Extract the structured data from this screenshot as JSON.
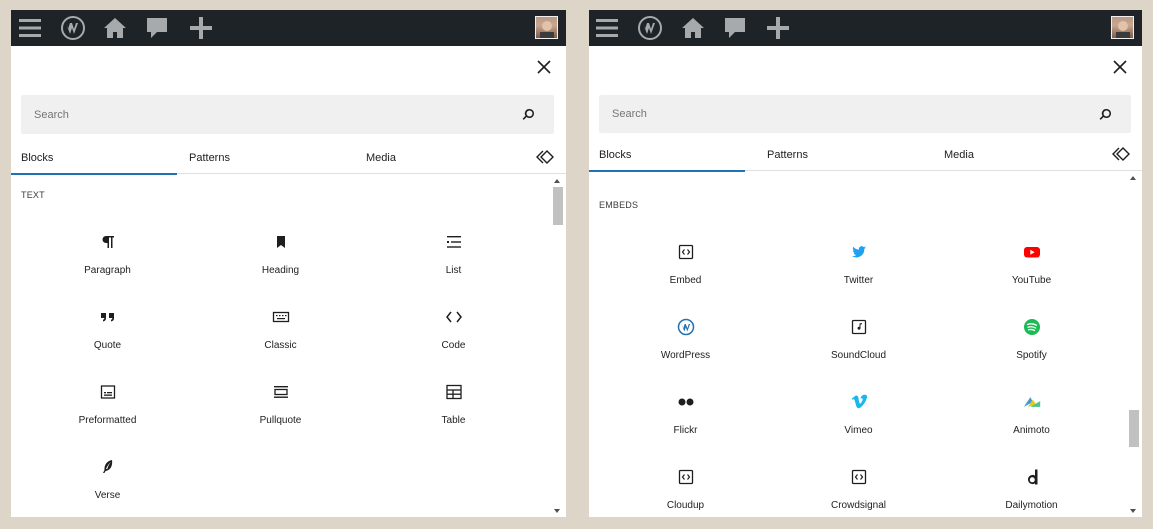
{
  "left_panel": {
    "search": {
      "placeholder": "Search"
    },
    "tabs": [
      {
        "label": "Blocks"
      },
      {
        "label": "Patterns"
      },
      {
        "label": "Media"
      }
    ],
    "category": "TEXT",
    "blocks": [
      {
        "label": "Paragraph",
        "icon": "paragraph-icon"
      },
      {
        "label": "Heading",
        "icon": "heading-icon"
      },
      {
        "label": "List",
        "icon": "list-icon"
      },
      {
        "label": "Quote",
        "icon": "quote-icon"
      },
      {
        "label": "Classic",
        "icon": "classic-icon"
      },
      {
        "label": "Code",
        "icon": "code-icon"
      },
      {
        "label": "Preformatted",
        "icon": "preformatted-icon"
      },
      {
        "label": "Pullquote",
        "icon": "pullquote-icon"
      },
      {
        "label": "Table",
        "icon": "table-icon"
      },
      {
        "label": "Verse",
        "icon": "verse-icon"
      }
    ]
  },
  "right_panel": {
    "search": {
      "placeholder": "Search"
    },
    "tabs": [
      {
        "label": "Blocks"
      },
      {
        "label": "Patterns"
      },
      {
        "label": "Media"
      }
    ],
    "category": "EMBEDS",
    "blocks": [
      {
        "label": "Embed",
        "icon": "embed-icon"
      },
      {
        "label": "Twitter",
        "icon": "twitter-icon"
      },
      {
        "label": "YouTube",
        "icon": "youtube-icon"
      },
      {
        "label": "WordPress",
        "icon": "wordpress-icon"
      },
      {
        "label": "SoundCloud",
        "icon": "soundcloud-icon"
      },
      {
        "label": "Spotify",
        "icon": "spotify-icon"
      },
      {
        "label": "Flickr",
        "icon": "flickr-icon"
      },
      {
        "label": "Vimeo",
        "icon": "vimeo-icon"
      },
      {
        "label": "Animoto",
        "icon": "animoto-icon"
      },
      {
        "label": "Cloudup",
        "icon": "cloudup-icon"
      },
      {
        "label": "Crowdsignal",
        "icon": "crowdsignal-icon"
      },
      {
        "label": "Dailymotion",
        "icon": "dailymotion-icon"
      }
    ]
  },
  "colors": {
    "adminbar": "#1d2327",
    "tab_indicator": "#2271b1",
    "twitter": "#1da1f2",
    "youtube": "#ff0000",
    "spotify": "#1db954",
    "vimeo": "#1ab7ea",
    "wordpress": "#2271b1"
  }
}
